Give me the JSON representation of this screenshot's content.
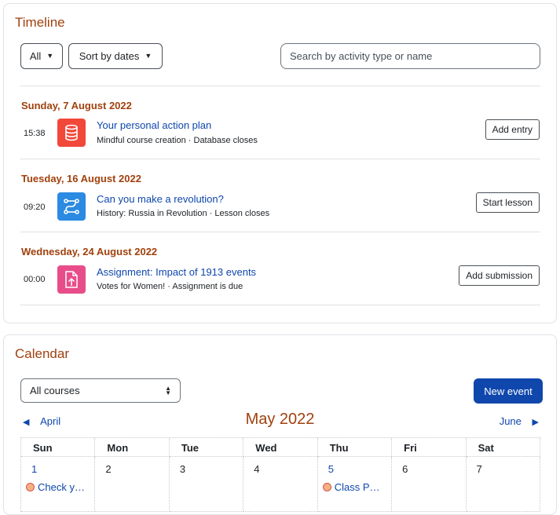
{
  "timeline": {
    "title": "Timeline",
    "filter_label": "All",
    "sort_label": "Sort by dates",
    "search_placeholder": "Search by activity type or name",
    "groups": [
      {
        "date": "Sunday, 7 August 2022",
        "time": "15:38",
        "icon": "database-icon",
        "icon_color": "#f1483a",
        "title": "Your personal action plan",
        "course": "Mindful course creation",
        "status": "Database closes",
        "subtitle": "Mindful course creation · Database closes",
        "action": "Add entry"
      },
      {
        "date": "Tuesday, 16 August 2022",
        "time": "09:20",
        "icon": "lesson-path-icon",
        "icon_color": "#2b8ae2",
        "title": "Can you make a revolution?",
        "course": "History: Russia in Revolution",
        "status": "Lesson closes",
        "subtitle": "History: Russia in Revolution · Lesson closes",
        "action": "Start lesson"
      },
      {
        "date": "Wednesday, 24 August 2022",
        "time": "00:00",
        "icon": "assignment-upload-icon",
        "icon_color": "#e84d8a",
        "title": "Assignment: Impact of 1913 events",
        "course": "Votes for Women!",
        "status": "Assignment is due",
        "subtitle": "Votes for Women! · Assignment is due",
        "action": "Add submission"
      }
    ]
  },
  "calendar": {
    "title": "Calendar",
    "course_select": "All courses",
    "new_event_label": "New event",
    "prev_month": "April",
    "next_month": "June",
    "month_title": "May 2022",
    "weekdays": [
      "Sun",
      "Mon",
      "Tue",
      "Wed",
      "Thu",
      "Fri",
      "Sat"
    ],
    "days": [
      {
        "num": "1",
        "event": "Check y…"
      },
      {
        "num": "2",
        "event": null
      },
      {
        "num": "3",
        "event": null
      },
      {
        "num": "4",
        "event": null
      },
      {
        "num": "5",
        "event": "Class P…"
      },
      {
        "num": "6",
        "event": null
      },
      {
        "num": "7",
        "event": null
      }
    ],
    "accent_color": "#0f47ad",
    "heading_color": "#a0410d"
  }
}
